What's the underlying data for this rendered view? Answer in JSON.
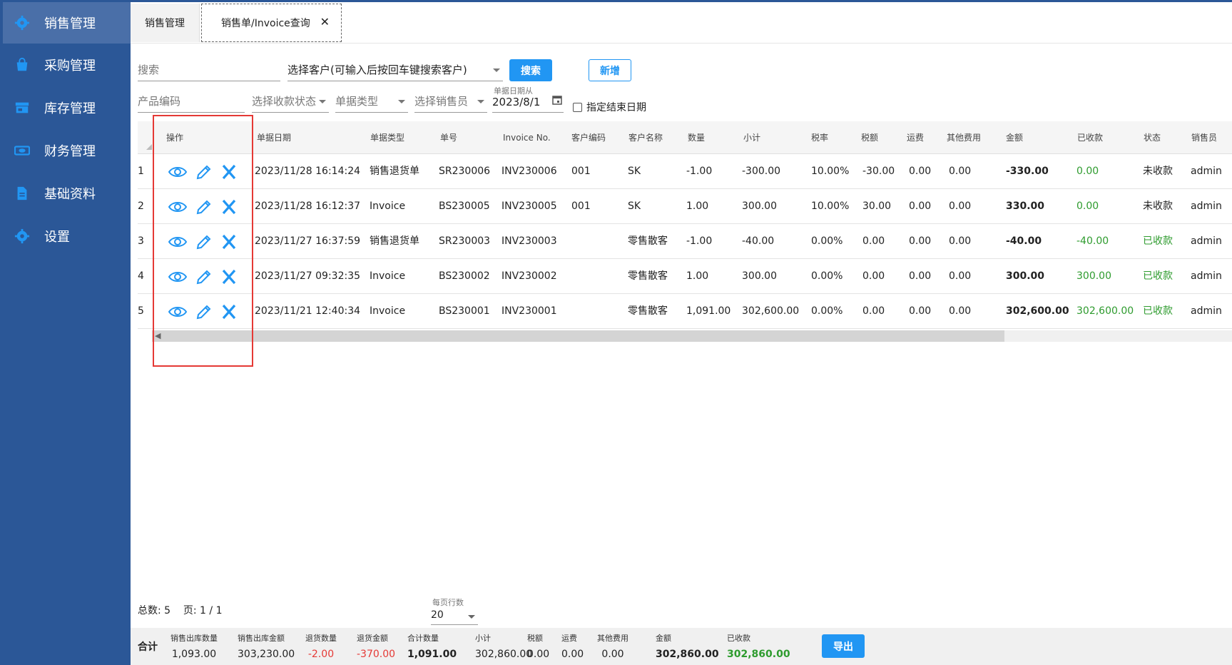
{
  "sidebar": {
    "items": [
      {
        "label": "销售管理",
        "icon": "gear-icon"
      },
      {
        "label": "采购管理",
        "icon": "shopping-bag-icon"
      },
      {
        "label": "库存管理",
        "icon": "store-icon"
      },
      {
        "label": "财务管理",
        "icon": "money-icon"
      },
      {
        "label": "基础资料",
        "icon": "document-icon"
      },
      {
        "label": "设置",
        "icon": "gear-icon"
      }
    ]
  },
  "tabs": [
    {
      "label": "销售管理"
    },
    {
      "label": "销售单/Invoice查询",
      "close": "✕"
    }
  ],
  "filters": {
    "search_placeholder": "搜索",
    "customer_placeholder": "选择客户(可输入后按回车键搜索客户)",
    "search_button": "搜索",
    "add_button": "新增",
    "product_code_placeholder": "产品编码",
    "payment_status_placeholder": "选择收款状态",
    "doc_type_placeholder": "单据类型",
    "salesperson_placeholder": "选择销售员",
    "date_from_label": "单据日期从",
    "date_from_value": "2023/8/1",
    "end_date_checkbox": "指定结束日期"
  },
  "table": {
    "columns": [
      "操作",
      "单据日期",
      "单据类型",
      "单号",
      "Invoice No.",
      "客户编码",
      "客户名称",
      "数量",
      "小计",
      "税率",
      "税额",
      "运费",
      "其他费用",
      "金额",
      "已收款",
      "状态",
      "销售员"
    ],
    "rows": [
      {
        "idx": "1",
        "date": "2023/11/28 16:14:24",
        "type": "销售退货单",
        "no": "SR230006",
        "invoice": "INV230006",
        "ccode": "001",
        "cname": "SK",
        "qty": "-1.00",
        "subtotal": "-300.00",
        "taxrate": "10.00%",
        "tax": "-30.00",
        "freight": "0.00",
        "other": "0.00",
        "amount": "-330.00",
        "received": "0.00",
        "status": "未收款",
        "sales": "admin"
      },
      {
        "idx": "2",
        "date": "2023/11/28 16:12:37",
        "type": "Invoice",
        "no": "BS230005",
        "invoice": "INV230005",
        "ccode": "001",
        "cname": "SK",
        "qty": "1.00",
        "subtotal": "300.00",
        "taxrate": "10.00%",
        "tax": "30.00",
        "freight": "0.00",
        "other": "0.00",
        "amount": "330.00",
        "received": "0.00",
        "status": "未收款",
        "sales": "admin"
      },
      {
        "idx": "3",
        "date": "2023/11/27 16:37:59",
        "type": "销售退货单",
        "no": "SR230003",
        "invoice": "INV230003",
        "ccode": "",
        "cname": "零售散客",
        "qty": "-1.00",
        "subtotal": "-40.00",
        "taxrate": "0.00%",
        "tax": "0.00",
        "freight": "0.00",
        "other": "0.00",
        "amount": "-40.00",
        "received": "-40.00",
        "status": "已收款",
        "sales": "admin"
      },
      {
        "idx": "4",
        "date": "2023/11/27 09:32:35",
        "type": "Invoice",
        "no": "BS230002",
        "invoice": "INV230002",
        "ccode": "",
        "cname": "零售散客",
        "qty": "1.00",
        "subtotal": "300.00",
        "taxrate": "0.00%",
        "tax": "0.00",
        "freight": "0.00",
        "other": "0.00",
        "amount": "300.00",
        "received": "300.00",
        "status": "已收款",
        "sales": "admin"
      },
      {
        "idx": "5",
        "date": "2023/11/21 12:40:34",
        "type": "Invoice",
        "no": "BS230001",
        "invoice": "INV230001",
        "ccode": "",
        "cname": "零售散客",
        "qty": "1,091.00",
        "subtotal": "302,600.00",
        "taxrate": "0.00%",
        "tax": "0.00",
        "freight": "0.00",
        "other": "0.00",
        "amount": "302,600.00",
        "received": "302,600.00",
        "status": "已收款",
        "sales": "admin"
      }
    ]
  },
  "pager": {
    "summary": "总数: 5    页: 1 / 1",
    "page_size_label": "每页行数",
    "page_size": "20"
  },
  "totals": {
    "label": "合计",
    "items": [
      {
        "h": "销售出库数量",
        "v": "1,093.00",
        "style": ""
      },
      {
        "h": "销售出库金额",
        "v": "303,230.00",
        "style": ""
      },
      {
        "h": "退货数量",
        "v": "-2.00",
        "style": "red"
      },
      {
        "h": "退货金额",
        "v": "-370.00",
        "style": "red"
      },
      {
        "h": "合计数量",
        "v": "1,091.00",
        "style": "bold"
      },
      {
        "h": "小计",
        "v": "302,860.00",
        "style": ""
      },
      {
        "h": "税额",
        "v": "0.00",
        "style": ""
      },
      {
        "h": "运费",
        "v": "0.00",
        "style": ""
      },
      {
        "h": "其他费用",
        "v": "0.00",
        "style": ""
      },
      {
        "h": "金额",
        "v": "302,860.00",
        "style": "bold"
      },
      {
        "h": "已收款",
        "v": "302,860.00",
        "style": "green"
      }
    ],
    "export_button": "导出"
  },
  "colors": {
    "sidebar": "#2b5797",
    "accent": "#2196f3",
    "green": "#2e9b2e",
    "red": "#e53935"
  }
}
